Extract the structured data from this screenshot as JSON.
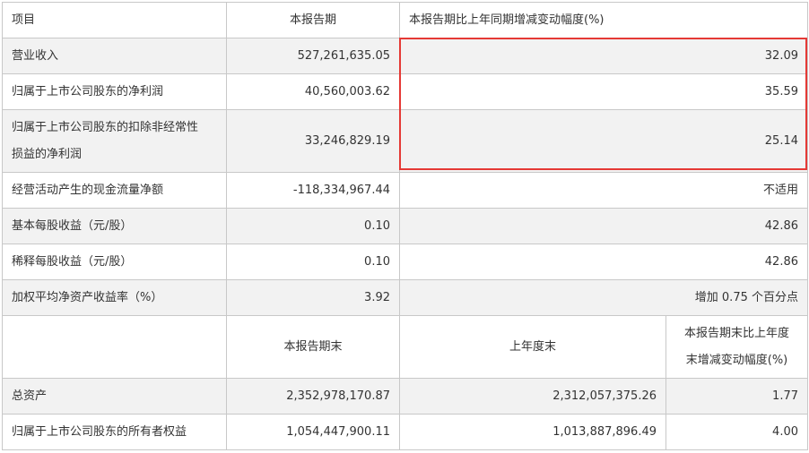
{
  "header": {
    "col_item": "项目",
    "col_current": "本报告期",
    "col_change": "本报告期比上年同期增减变动幅度(%)"
  },
  "rows": [
    {
      "label": "营业收入",
      "value": "527,261,635.05",
      "change": "32.09"
    },
    {
      "label": "归属于上市公司股东的净利润",
      "value": "40,560,003.62",
      "change": "35.59"
    },
    {
      "label_line1": "归属于上市公司股东的扣除非经常性",
      "label_line2": "损益的净利润",
      "value": "33,246,829.19",
      "change": "25.14"
    },
    {
      "label": "经营活动产生的现金流量净额",
      "value": "-118,334,967.44",
      "change": "不适用"
    },
    {
      "label": "基本每股收益（元/股）",
      "value": "0.10",
      "change": "42.86"
    },
    {
      "label": "稀释每股收益（元/股）",
      "value": "0.10",
      "change": "42.86"
    },
    {
      "label": "加权平均净资产收益率（%）",
      "value": "3.92",
      "change": "增加 0.75 个百分点"
    }
  ],
  "subheader": {
    "col_period_end": "本报告期末",
    "col_prev_year_end": "上年度末",
    "col_change_line1": "本报告期末比上年度",
    "col_change_line2": "末增减变动幅度(%)"
  },
  "balance_rows": [
    {
      "label": "总资产",
      "period_end": "2,352,978,170.87",
      "prev_year_end": "2,312,057,375.26",
      "change": "1.77"
    },
    {
      "label": "归属于上市公司股东的所有者权益",
      "period_end": "1,054,447,900.11",
      "prev_year_end": "1,013,887,896.49",
      "change": "4.00"
    }
  ],
  "colors": {
    "highlight_border": "#e53935",
    "row_shade": "#f2f2f2",
    "grid": "#c8c8c8"
  }
}
